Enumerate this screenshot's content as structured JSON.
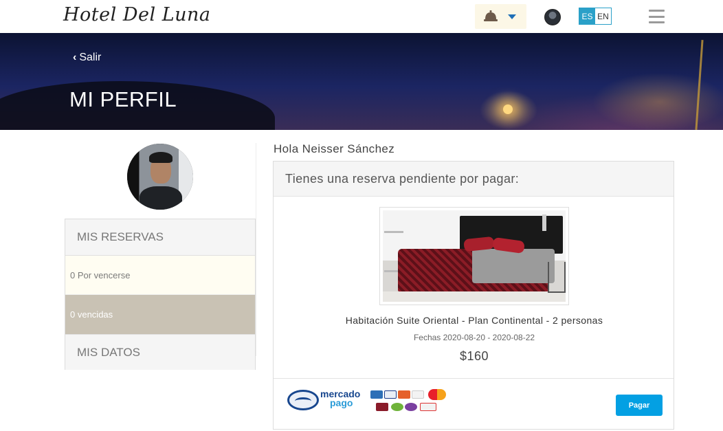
{
  "header": {
    "logo_text": "Hotel Del Luna",
    "lang_es": "ES",
    "lang_en": "EN"
  },
  "banner": {
    "back_label": "Salir",
    "title": "MI PERFIL"
  },
  "sidebar": {
    "reservations_heading": "MIS RESERVAS",
    "pending_item": "0 Por vencerse",
    "expired_item": "0 vencidas",
    "data_heading": "MIS DATOS"
  },
  "main": {
    "greeting": "Hola Neisser Sánchez",
    "card_title": "Tienes una reserva pendiente por pagar:",
    "room_name": "Habitación Suite Oriental - Plan Continental - 2 personas",
    "dates": "Fechas 2020-08-20 - 2020-08-22",
    "price": "$160",
    "payment_brand_line1": "mercado",
    "payment_brand_line2": "pago",
    "pay_button": "Pagar"
  },
  "colors": {
    "accent": "#03a0e3",
    "lang_active": "#2aa0c8",
    "expired_bg": "#c9c2b4",
    "pending_bg": "#fffdf2"
  },
  "icons": {
    "bell": "service-bell-icon",
    "caret": "caret-down-icon",
    "menu": "hamburger-icon",
    "back": "chevron-left-icon"
  }
}
